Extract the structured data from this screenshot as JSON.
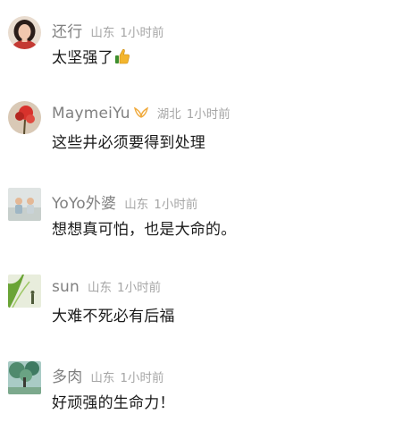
{
  "comments": [
    {
      "user": "还行",
      "location": "山东",
      "time": "1小时前",
      "text": "太坚强了",
      "emoji": "thumbs-up"
    },
    {
      "user": "MaymeiYu",
      "location": "湖北",
      "time": "1小时前",
      "text": "这些井必须要得到处理"
    },
    {
      "user": "YoYo外婆",
      "location": "山东",
      "time": "1小时前",
      "text": "想想真可怕，也是大命的。"
    },
    {
      "user": "sun",
      "location": "山东",
      "time": "1小时前",
      "text": "大难不死必有后福"
    },
    {
      "user": "多肉",
      "location": "山东",
      "time": "1小时前",
      "text": "好顽强的生命力！"
    }
  ]
}
